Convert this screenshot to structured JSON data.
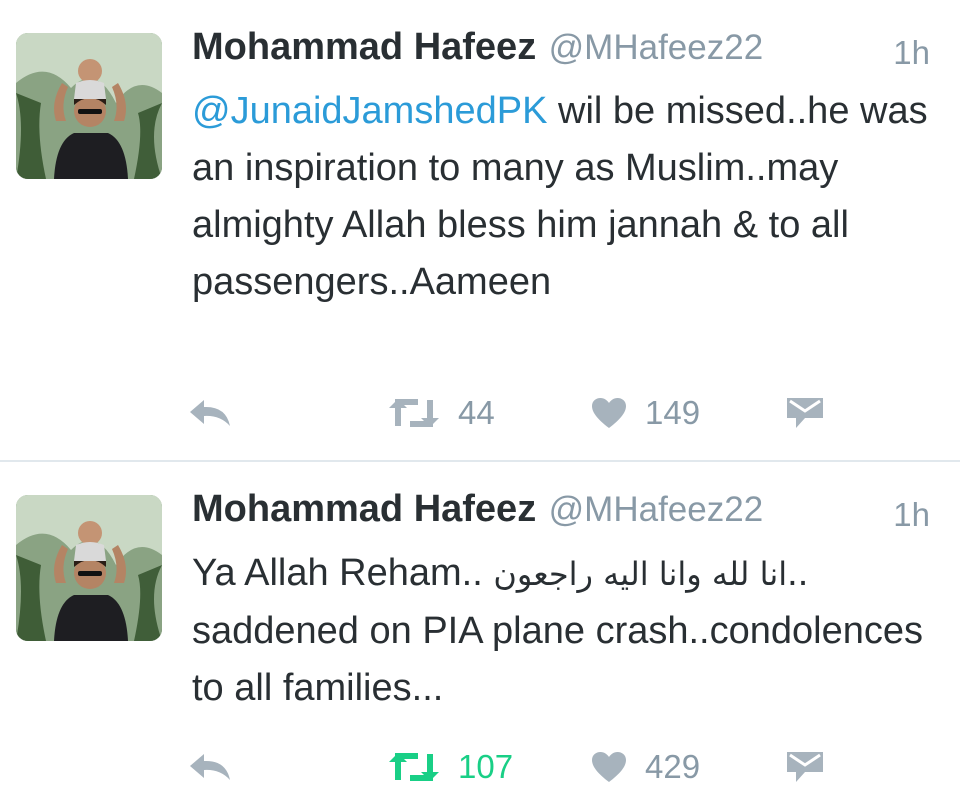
{
  "tweets": [
    {
      "author_name": "Mohammad Hafeez",
      "handle": "@MHafeez22",
      "time": "1h",
      "mention": "@JunaidJamshedPK",
      "text": " wil be missed..he was an inspiration to many as Muslim..may almighty Allah bless him jannah & to all passengers..Aameen",
      "retweets": "44",
      "likes": "149",
      "retweet_color": "#8899a6",
      "reply_icon": "reply-icon",
      "retweet_icon": "retweet-icon",
      "like_icon": "heart-icon",
      "dm_icon": "envelope-icon"
    },
    {
      "author_name": "Mohammad Hafeez",
      "handle": "@MHafeez22",
      "time": "1h",
      "text_lead": "Ya Allah Reham..",
      "text_arabic": "انا لله وانا اليه راجعون",
      "text_trail": ".. saddened on PIA plane crash..condolences to all families...",
      "retweets": "107",
      "likes": "429",
      "retweet_color": "#19cf86",
      "reply_icon": "reply-icon",
      "retweet_icon": "retweet-icon",
      "like_icon": "heart-icon",
      "dm_icon": "envelope-icon"
    }
  ],
  "colors": {
    "name": "#292f33",
    "secondary": "#8899a6",
    "link": "#2b9bd8",
    "retweeted": "#19cf86",
    "divider": "#e1e8ed"
  }
}
